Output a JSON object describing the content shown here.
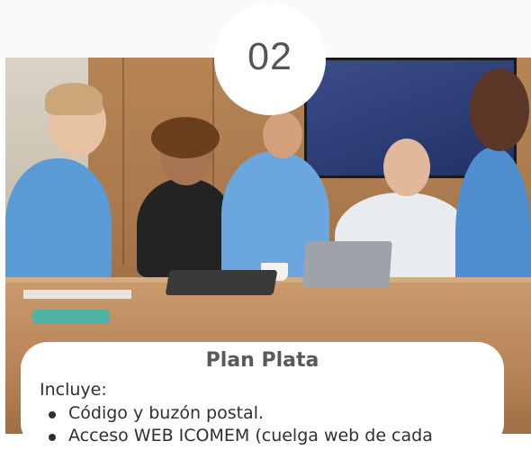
{
  "step": {
    "number": "02"
  },
  "plan": {
    "title": "Plan Plata",
    "intro": "Incluye:",
    "items": [
      "Código y buzón postal.",
      "Acceso WEB ICOMEM (cuelga web de cada"
    ]
  },
  "colors": {
    "badge_text": "#555555",
    "card_bg": "#ffffff",
    "scrub_blue": "#5b9bd5"
  }
}
